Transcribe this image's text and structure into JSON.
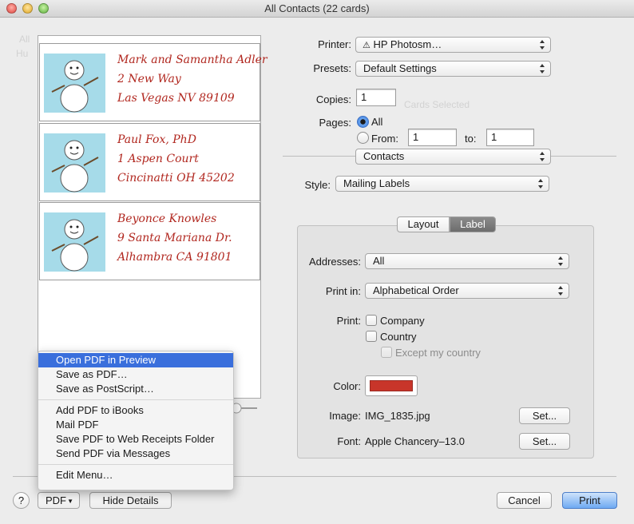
{
  "window": {
    "title": "All Contacts (22 cards)"
  },
  "background_ghosts": {
    "cards_selected": "Cards Selected"
  },
  "preview": {
    "cards": [
      {
        "lines": [
          "Mark and Samantha Adler",
          "2 New Way",
          "Las Vegas NV 89109"
        ]
      },
      {
        "lines": [
          "Paul Fox, PhD",
          "1 Aspen Court",
          "Cincinatti OH 45202"
        ]
      },
      {
        "lines": [
          "Beyonce Knowles",
          "9 Santa Mariana Dr.",
          "Alhambra CA 91801"
        ]
      }
    ]
  },
  "printer": {
    "label": "Printer:",
    "value": "HP Photosm…",
    "warning_icon": "warning-icon"
  },
  "presets": {
    "label": "Presets:",
    "value": "Default Settings"
  },
  "copies": {
    "label": "Copies:",
    "value": "1"
  },
  "pages": {
    "label": "Pages:",
    "all_label": "All",
    "from_label": "From:",
    "from_value": "1",
    "to_label": "to:",
    "to_value": "1"
  },
  "section_popup": {
    "value": "Contacts"
  },
  "style": {
    "label": "Style:",
    "value": "Mailing Labels"
  },
  "tabs": {
    "layout": "Layout",
    "label": "Label",
    "selected": "Label"
  },
  "label_panel": {
    "addresses": {
      "label": "Addresses:",
      "value": "All"
    },
    "print_in": {
      "label": "Print in:",
      "value": "Alphabetical Order"
    },
    "print": {
      "label": "Print:",
      "company": "Company",
      "country": "Country",
      "except_country": "Except my country"
    },
    "color": {
      "label": "Color:",
      "value": "#c8352a"
    },
    "image": {
      "label": "Image:",
      "value": "IMG_1835.jpg",
      "set_label": "Set..."
    },
    "font": {
      "label": "Font:",
      "value": "Apple Chancery–13.0",
      "set_label": "Set..."
    }
  },
  "bottom": {
    "help": "?",
    "pdf_label": "PDF",
    "hide_details": "Hide Details",
    "cancel": "Cancel",
    "print": "Print"
  },
  "pdf_menu": {
    "groups": [
      [
        "Open PDF in Preview",
        "Save as PDF…",
        "Save as PostScript…"
      ],
      [
        "Add PDF to iBooks",
        "Mail PDF",
        "Save PDF to Web Receipts Folder",
        "Send PDF via Messages"
      ],
      [
        "Edit Menu…"
      ]
    ],
    "highlighted": "Open PDF in Preview"
  }
}
